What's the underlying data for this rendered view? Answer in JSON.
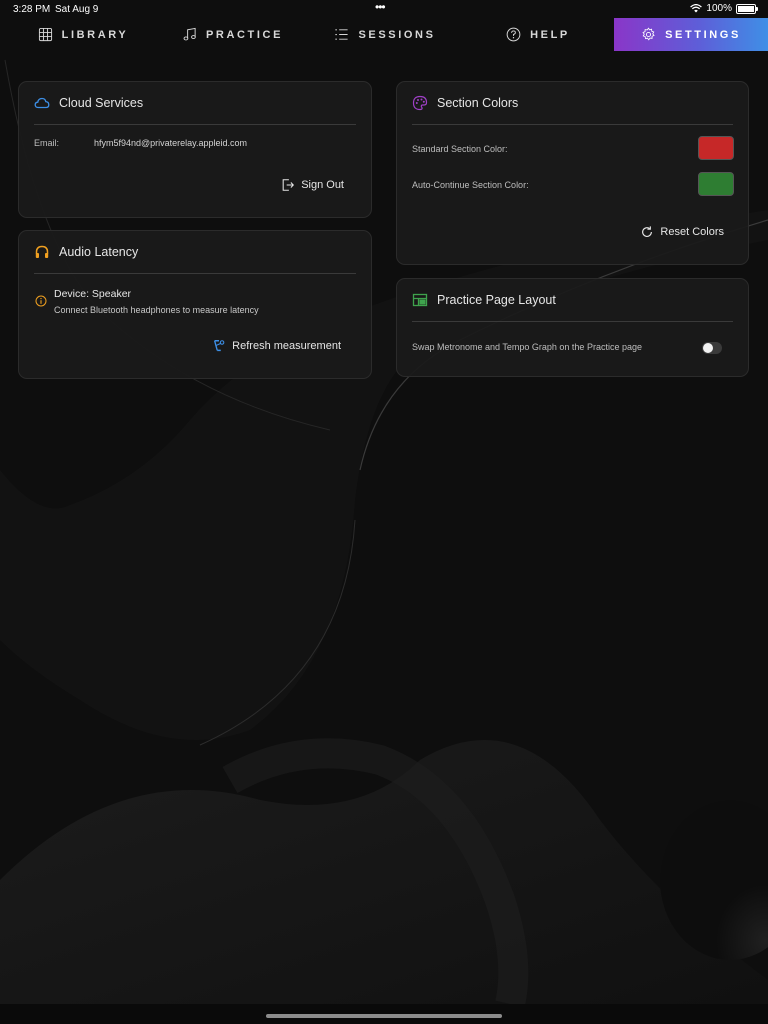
{
  "status_bar": {
    "time": "3:28 PM",
    "date": "Sat Aug 9",
    "battery": "100%"
  },
  "nav": {
    "tabs": [
      {
        "label": "LIBRARY",
        "icon": "grid-icon",
        "active": false
      },
      {
        "label": "PRACTICE",
        "icon": "music-note-icon",
        "active": false
      },
      {
        "label": "SESSIONS",
        "icon": "list-icon",
        "active": false
      },
      {
        "label": "HELP",
        "icon": "help-circle-icon",
        "active": false
      },
      {
        "label": "SETTINGS",
        "icon": "gear-icon",
        "active": true
      }
    ],
    "active_gradient": [
      "#8a36c8",
      "#3f8fe6"
    ]
  },
  "cloud": {
    "title": "Cloud Services",
    "email_label": "Email:",
    "email_value": "hfym5f94nd@privaterelay.appleid.com",
    "sign_out_label": "Sign Out",
    "icon_color": "#3d8fe6"
  },
  "latency": {
    "title": "Audio Latency",
    "device": "Device: Speaker",
    "hint": "Connect Bluetooth headphones to measure latency",
    "refresh_label": "Refresh measurement",
    "icon_color": "#f0a020"
  },
  "section_colors": {
    "title": "Section Colors",
    "standard_label": "Standard Section Color:",
    "standard_color": "#c62828",
    "auto_label": "Auto-Continue Section Color:",
    "auto_color": "#2e7d32",
    "reset_label": "Reset Colors",
    "icon_color": "#a040c8"
  },
  "layout": {
    "title": "Practice Page Layout",
    "swap_label": "Swap Metronome and Tempo Graph on the Practice page",
    "swap_enabled": false,
    "icon_color": "#3fa34d"
  }
}
